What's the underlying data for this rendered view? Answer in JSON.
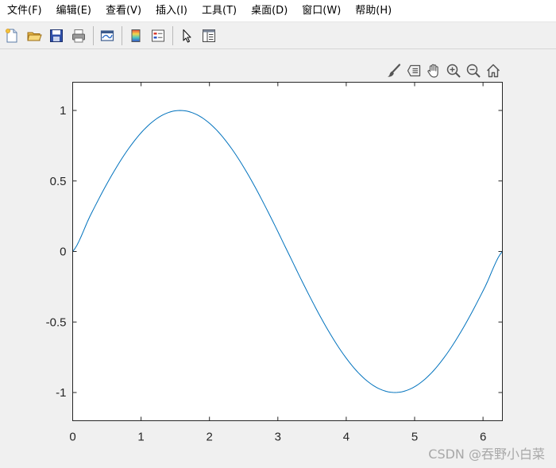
{
  "menubar": {
    "items": [
      {
        "label": "文件(F)"
      },
      {
        "label": "编辑(E)"
      },
      {
        "label": "查看(V)"
      },
      {
        "label": "插入(I)"
      },
      {
        "label": "工具(T)"
      },
      {
        "label": "桌面(D)"
      },
      {
        "label": "窗口(W)"
      },
      {
        "label": "帮助(H)"
      }
    ]
  },
  "toolbar": {
    "icons": [
      "new-figure-icon",
      "open-file-icon",
      "save-icon",
      "print-icon",
      "link-plot-icon",
      "colorbar-icon",
      "legend-icon",
      "edit-plot-arrow-icon",
      "property-inspector-icon"
    ]
  },
  "axes_toolbar": {
    "icons": [
      "brush-icon",
      "data-tips-icon",
      "pan-hand-icon",
      "zoom-in-icon",
      "zoom-out-icon",
      "restore-view-icon"
    ]
  },
  "chart_data": {
    "type": "line",
    "title": "",
    "xlabel": "",
    "ylabel": "",
    "xlim": [
      0,
      6.2832
    ],
    "ylim": [
      -1.2,
      1.2
    ],
    "xticks": [
      0,
      1,
      2,
      3,
      4,
      5,
      6
    ],
    "xtick_labels": [
      "0",
      "1",
      "2",
      "3",
      "4",
      "5",
      "6"
    ],
    "yticks": [
      -1,
      -0.5,
      0,
      0.5,
      1
    ],
    "ytick_labels": [
      "-1",
      "-0.5",
      "0",
      "0.5",
      "1"
    ],
    "grid": false,
    "series": [
      {
        "function": "sin(x)",
        "color": "#0072bd",
        "x": [
          0,
          0.2618,
          0.5236,
          0.7854,
          1.0472,
          1.309,
          1.5708,
          1.8326,
          2.0944,
          2.3562,
          2.618,
          2.8798,
          3.1416,
          3.4034,
          3.6652,
          3.927,
          4.1888,
          4.4506,
          4.7124,
          4.9742,
          5.236,
          5.4978,
          5.7596,
          6.0214,
          6.2832
        ],
        "y": [
          0,
          0.2588,
          0.5,
          0.7071,
          0.866,
          0.9659,
          1,
          0.9659,
          0.866,
          0.7071,
          0.5,
          0.2588,
          0,
          -0.2588,
          -0.5,
          -0.7071,
          -0.866,
          -0.9659,
          -1,
          -0.9659,
          -0.866,
          -0.7071,
          -0.5,
          -0.2588,
          0
        ]
      }
    ]
  },
  "watermark": {
    "text": "CSDN @吞野小白菜"
  }
}
